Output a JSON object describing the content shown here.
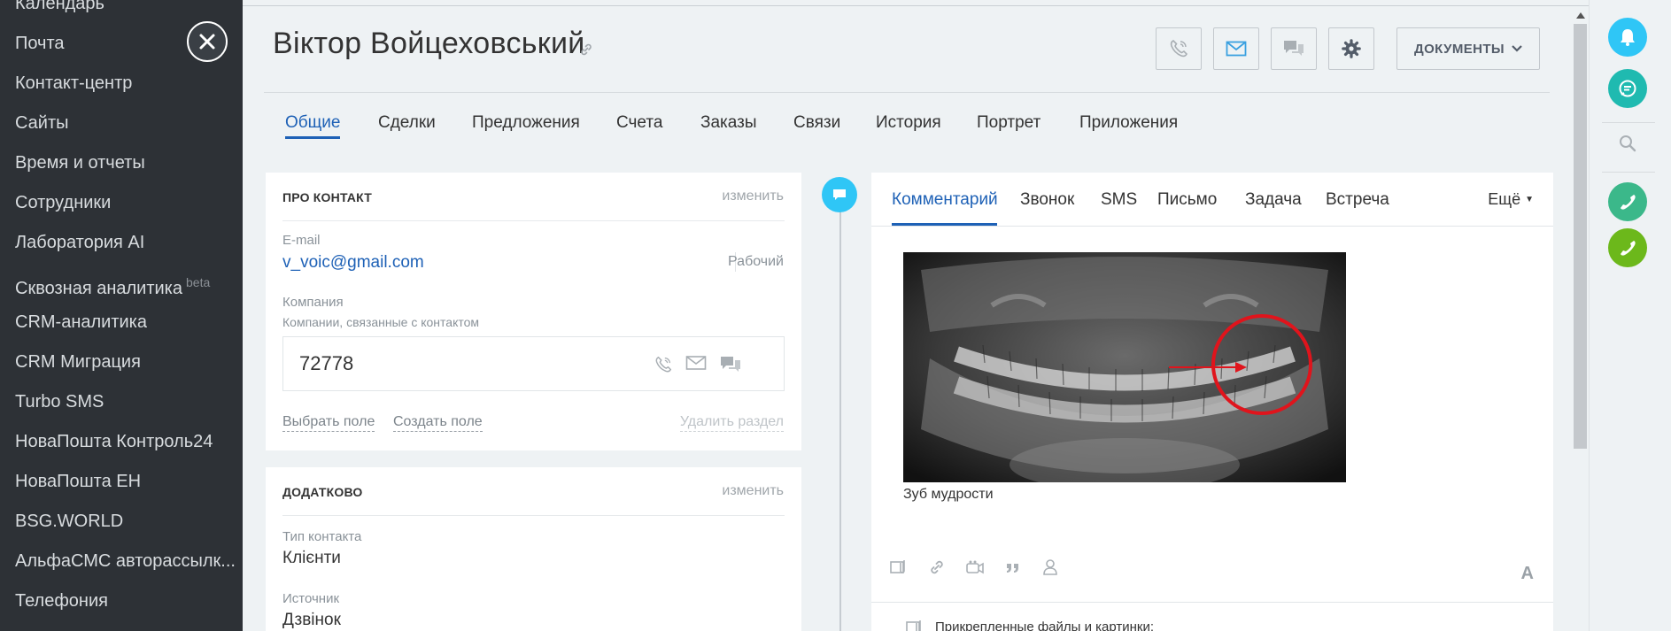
{
  "sidebar": {
    "items": [
      {
        "label": "Календарь"
      },
      {
        "label": "Почта"
      },
      {
        "label": "Контакт-центр"
      },
      {
        "label": "Сайты"
      },
      {
        "label": "Время и отчеты"
      },
      {
        "label": "Сотрудники"
      },
      {
        "label": "Лаборатория AI"
      },
      {
        "label": "Сквозная аналитика",
        "badge": "beta"
      },
      {
        "label": "CRM-аналитика"
      },
      {
        "label": "CRM Миграция"
      },
      {
        "label": "Turbo SMS"
      },
      {
        "label": "НоваПошта Контроль24"
      },
      {
        "label": "НоваПошта ЕН"
      },
      {
        "label": "BSG.WORLD"
      },
      {
        "label": "АльфаСМС авторассылк..."
      },
      {
        "label": "Телефония"
      }
    ]
  },
  "header": {
    "title": "Віктор Войцеховський",
    "documents_label": "ДОКУМЕНТЫ"
  },
  "tabs": [
    {
      "label": "Общие"
    },
    {
      "label": "Сделки"
    },
    {
      "label": "Предложения"
    },
    {
      "label": "Счета"
    },
    {
      "label": "Заказы"
    },
    {
      "label": "Связи"
    },
    {
      "label": "История"
    },
    {
      "label": "Портрет"
    },
    {
      "label": "Приложения"
    }
  ],
  "about": {
    "title": "ПРО КОНТАКТ",
    "edit": "изменить",
    "email_label": "E-mail",
    "email_value": "v_voic@gmail.com",
    "email_type": "Рабочий",
    "company_label": "Компания",
    "company_sublabel": "Компании, связанные с контактом",
    "company_value": "72778",
    "select_field": "Выбрать поле",
    "create_field": "Создать поле",
    "delete_section": "Удалить раздел"
  },
  "extra": {
    "title": "ДОДАТКОВО",
    "edit": "изменить",
    "type_label": "Тип контакта",
    "type_value": "Клієнти",
    "source_label": "Источник",
    "source_value": "Дзвінок"
  },
  "editor": {
    "tabs": [
      {
        "label": "Комментарий"
      },
      {
        "label": "Звонок"
      },
      {
        "label": "SMS"
      },
      {
        "label": "Письмо"
      },
      {
        "label": "Задача"
      },
      {
        "label": "Встреча"
      }
    ],
    "more": "Ещё",
    "caption": "Зуб мудрости",
    "font_button": "A",
    "attached_files": "Прикрепленные файлы и картинки:"
  },
  "colors": {
    "accent": "#1e61b6",
    "sidebar_bg": "#2d3136",
    "timeline_dot": "#2fc6f6",
    "notify": "#2fc6f6",
    "chat": "#1fbab0",
    "call1": "#3bb88a",
    "call2": "#6cb81b",
    "annotation": "#e0141c"
  }
}
